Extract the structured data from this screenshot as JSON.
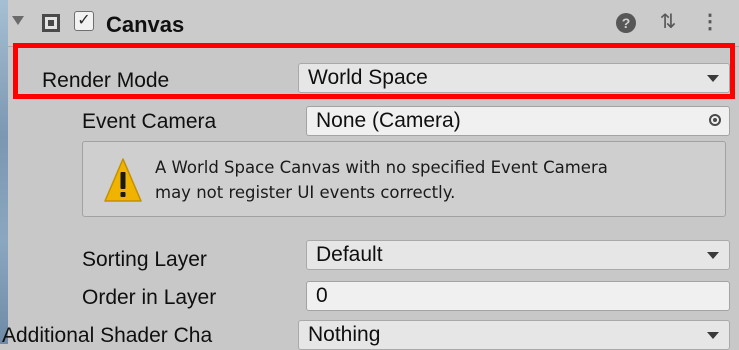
{
  "component": {
    "title": "Canvas",
    "enabled_check": "✓",
    "help_glyph": "?",
    "presets_glyph": "⇅",
    "more_glyph": "⋮"
  },
  "render_mode": {
    "label": "Render Mode",
    "value": "World Space"
  },
  "event_camera": {
    "label": "Event Camera",
    "value": "None (Camera)"
  },
  "warning": {
    "line1": "A World Space Canvas with no specified Event Camera",
    "line2": "may not register UI events correctly."
  },
  "sorting_layer": {
    "label": "Sorting Layer",
    "value": "Default"
  },
  "order_in_layer": {
    "label": "Order in Layer",
    "value": "0"
  },
  "shader_channels": {
    "label": "Additional Shader Cha",
    "value": "Nothing"
  },
  "colors": {
    "panel_bg": "#c8c8c8",
    "highlight": "#ff0000",
    "warning_yellow": "#f0b400"
  },
  "icons": {
    "foldout": "foldout-arrow-icon",
    "component": "canvas-component-icon",
    "help": "help-icon",
    "presets": "presets-icon",
    "more": "more-menu-icon",
    "object_picker": "object-picker-icon",
    "warning": "warning-icon"
  }
}
